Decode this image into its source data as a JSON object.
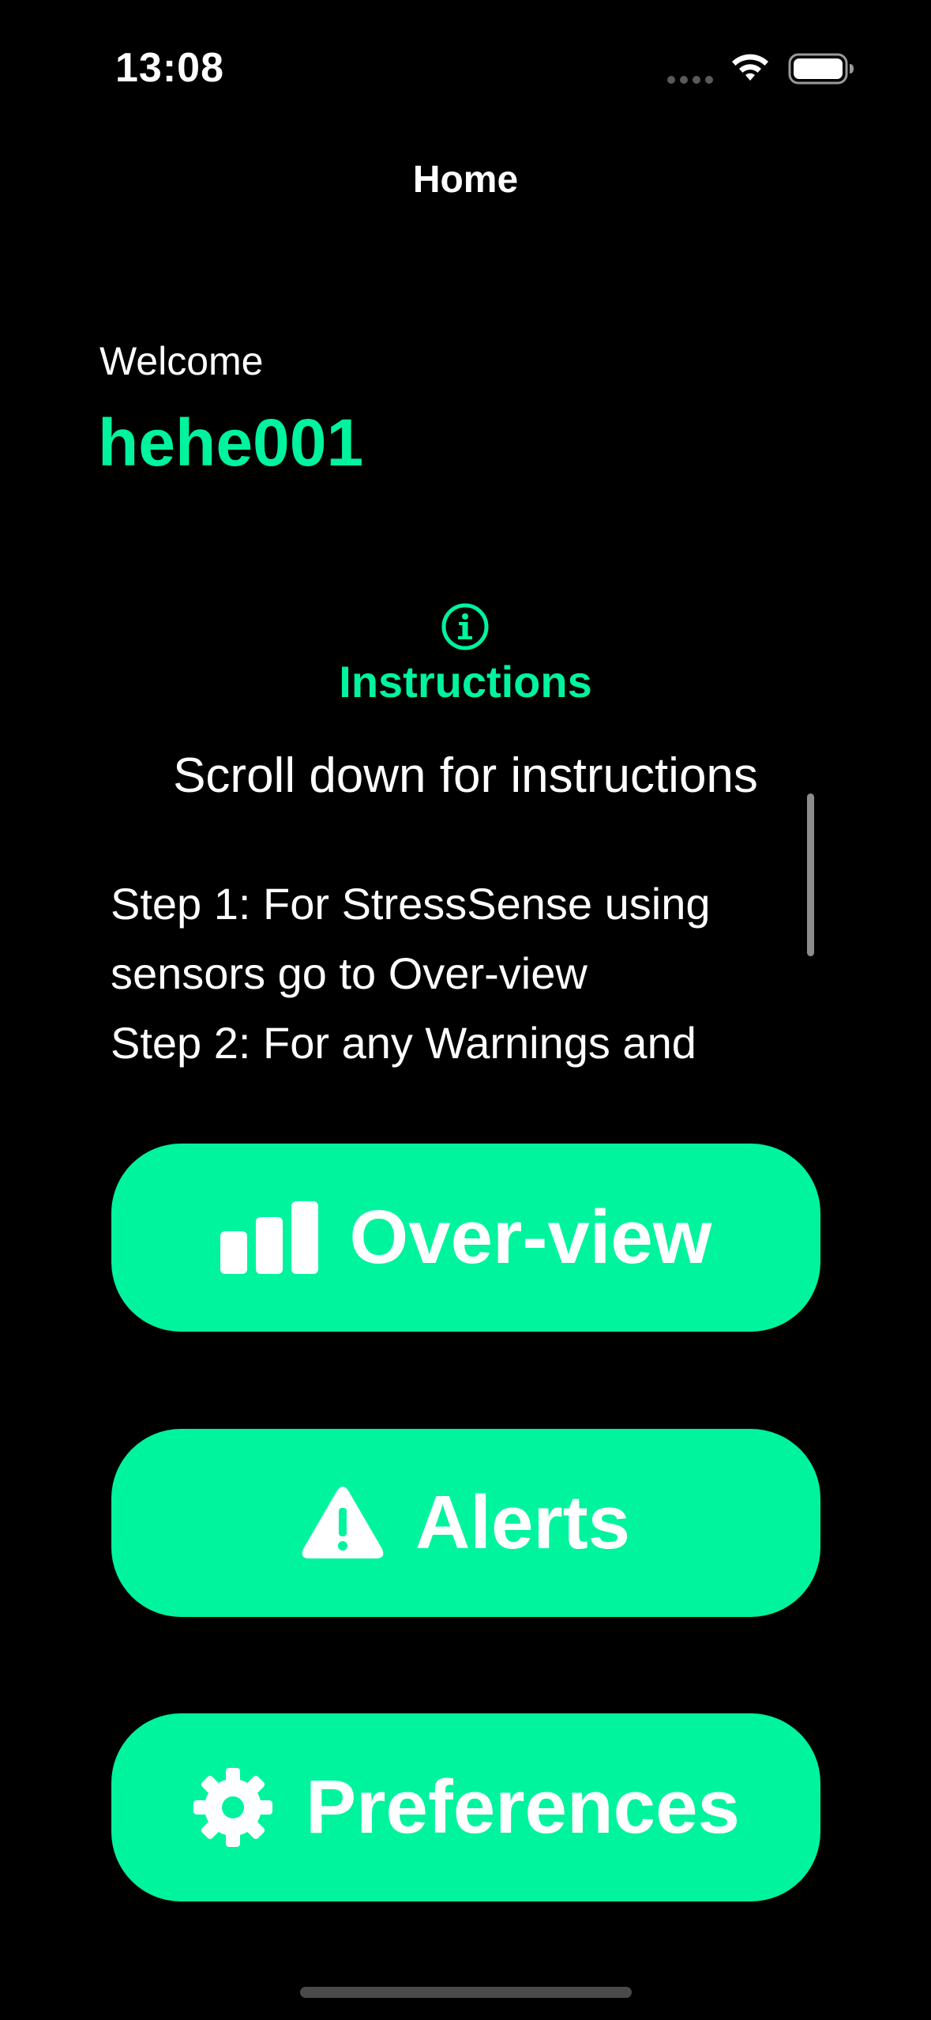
{
  "theme": {
    "accent": "#00F49D",
    "background": "#000000",
    "text": "#FFFFFF"
  },
  "status_bar": {
    "time": "13:08",
    "icons": [
      "signal-dots-icon",
      "wifi-icon",
      "battery-icon"
    ]
  },
  "nav": {
    "title": "Home"
  },
  "welcome": {
    "label": "Welcome",
    "username": "hehe001"
  },
  "instructions": {
    "icon": "info-circle-icon",
    "title": "Instructions",
    "scroll_hint": "Scroll down for instructions",
    "body": "Step 1: For StressSense using sensors go to Over-view\nStep 2: For any Warnings and"
  },
  "buttons": {
    "overview": {
      "label": "Over-view",
      "icon": "bar-chart-icon"
    },
    "alerts": {
      "label": "Alerts",
      "icon": "warning-triangle-icon"
    },
    "preferences": {
      "label": "Preferences",
      "icon": "gear-icon"
    }
  }
}
